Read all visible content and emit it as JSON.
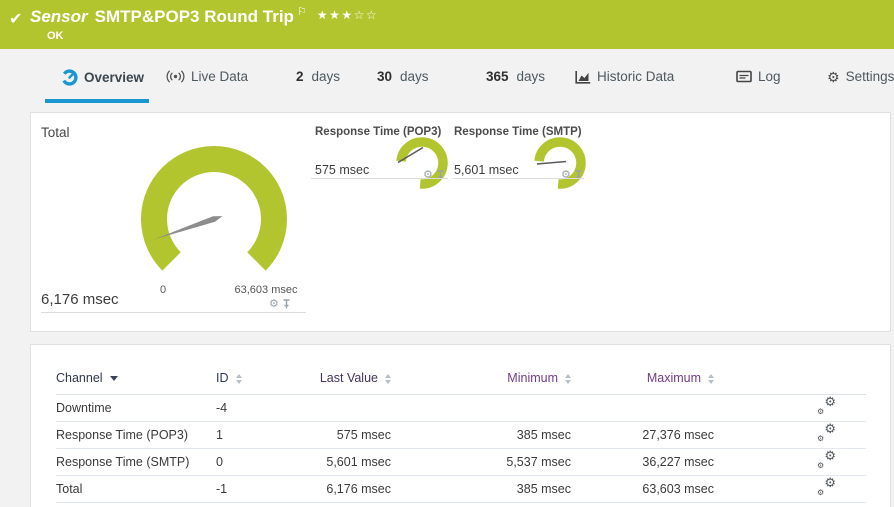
{
  "colors": {
    "brand_green": "#b2c52f",
    "accent_blue": "#1a96d3",
    "needle_gray": "#8d8d8d",
    "header_purple": "#6f3c86"
  },
  "icons": {
    "gear": "⚙",
    "check": "✔",
    "flag": "⚐",
    "stars": "★★★☆☆"
  },
  "sensor_header": {
    "kind": "Sensor",
    "title": "SMTP&POP3 Round Trip",
    "status": "OK"
  },
  "tabs": {
    "overview": {
      "label": "Overview"
    },
    "live": {
      "label": "Live Data"
    },
    "d2": {
      "num": "2",
      "unit": "days"
    },
    "d30": {
      "num": "30",
      "unit": "days"
    },
    "d365": {
      "num": "365",
      "unit": "days"
    },
    "historic": {
      "label": "Historic Data"
    },
    "log": {
      "label": "Log"
    },
    "settings": {
      "label": "Settings"
    }
  },
  "gauges": {
    "total": {
      "title": "Total",
      "value": "6,176 msec",
      "min_label": "0",
      "max_label": "63,603 msec",
      "value_num": 6176,
      "min": 0,
      "max": 63603
    },
    "pop3": {
      "title": "Response Time (POP3)",
      "value": "575 msec",
      "value_num": 575
    },
    "smtp": {
      "title": "Response Time (SMTP)",
      "value": "5,601 msec",
      "value_num": 5601
    }
  },
  "channel_table": {
    "headers": {
      "channel": "Channel",
      "id": "ID",
      "last": "Last Value",
      "min": "Minimum",
      "max": "Maximum"
    },
    "rows": [
      {
        "channel": "Downtime",
        "id": "-4",
        "last": "",
        "min": "",
        "max": ""
      },
      {
        "channel": "Response Time (POP3)",
        "id": "1",
        "last": "575 msec",
        "min": "385 msec",
        "max": "27,376 msec"
      },
      {
        "channel": "Response Time (SMTP)",
        "id": "0",
        "last": "5,601 msec",
        "min": "5,537 msec",
        "max": "36,227 msec"
      },
      {
        "channel": "Total",
        "id": "-1",
        "last": "6,176 msec",
        "min": "385 msec",
        "max": "63,603 msec"
      }
    ]
  }
}
